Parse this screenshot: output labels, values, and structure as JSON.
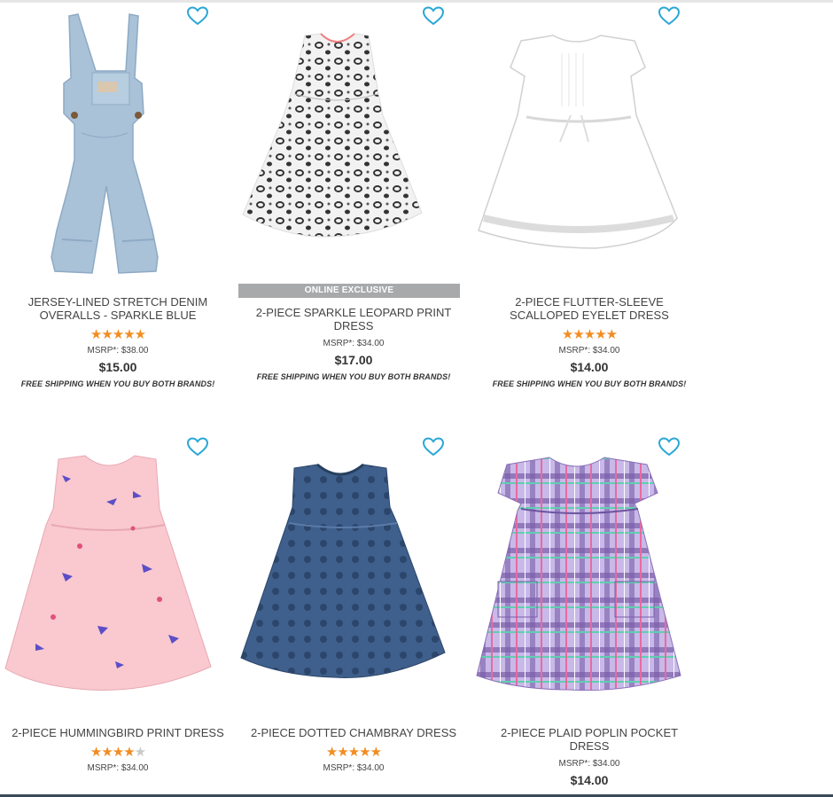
{
  "products": [
    {
      "title": "JERSEY-LINED STRETCH DENIM OVERALLS - SPARKLE BLUE",
      "badge": "",
      "rating": 5,
      "msrp": "MSRP*: $38.00",
      "price": "$15.00",
      "shipping": "FREE SHIPPING WHEN YOU BUY BOTH BRANDS!",
      "image": "denim-overalls",
      "colors": [
        "#a9c2d8",
        "#8eaac4"
      ]
    },
    {
      "title": "2-PIECE SPARKLE LEOPARD PRINT DRESS",
      "badge": "ONLINE EXCLUSIVE",
      "rating": 0,
      "msrp": "MSRP*: $34.00",
      "price": "$17.00",
      "shipping": "FREE SHIPPING WHEN YOU BUY BOTH BRANDS!",
      "image": "leopard-dress",
      "colors": [
        "#f2f2f2",
        "#3a3a3a"
      ]
    },
    {
      "title": "2-PIECE FLUTTER-SLEEVE SCALLOPED EYELET DRESS",
      "badge": "",
      "rating": 5,
      "msrp": "MSRP*: $34.00",
      "price": "$14.00",
      "shipping": "FREE SHIPPING WHEN YOU BUY BOTH BRANDS!",
      "image": "white-eyelet-dress",
      "colors": [
        "#ffffff",
        "#dcdcdc"
      ]
    },
    {
      "title": "2-PIECE HUMMINGBIRD PRINT DRESS",
      "badge": "",
      "rating": 4,
      "msrp": "MSRP*: $34.00",
      "price": "",
      "shipping": "",
      "image": "pink-hummingbird-dress",
      "colors": [
        "#f9c9cf",
        "#5b4ec7"
      ]
    },
    {
      "title": "2-PIECE DOTTED CHAMBRAY DRESS",
      "badge": "",
      "rating": 5,
      "msrp": "MSRP*: $34.00",
      "price": "",
      "shipping": "",
      "image": "chambray-dress",
      "colors": [
        "#3f5f8c",
        "#2c466b"
      ]
    },
    {
      "title": "2-PIECE PLAID POPLIN POCKET DRESS",
      "badge": "",
      "rating": 0,
      "msrp": "MSRP*: $34.00",
      "price": "$14.00",
      "shipping": "",
      "image": "plaid-dress",
      "colors": [
        "#b8a6dc",
        "#7a5ea8"
      ]
    }
  ],
  "ui": {
    "heart_icon": "heart-outline-icon",
    "heart_color": "#2aa7d6",
    "star_color": "#f18d21"
  }
}
